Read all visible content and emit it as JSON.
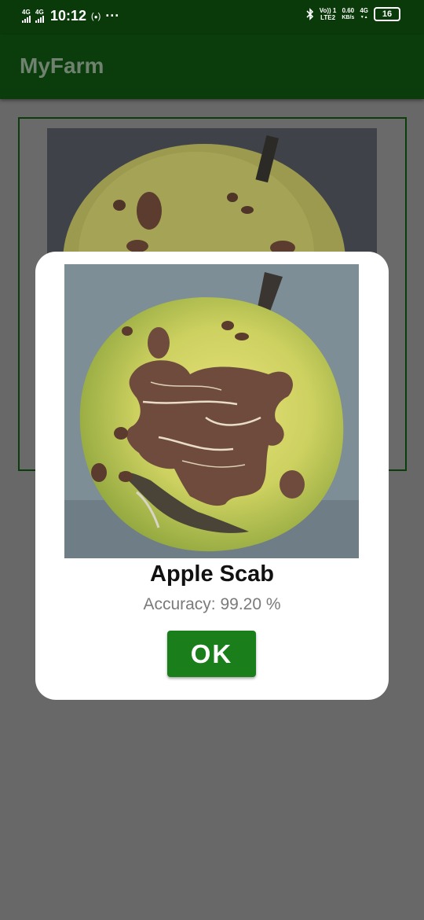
{
  "status_bar": {
    "sim1_label": "4G",
    "sim2_label": "4G",
    "time": "10:12",
    "hotspot_icon": "hotspot-icon",
    "more_icon": "···",
    "bluetooth_icon": "bluetooth-icon",
    "volte_top": "Vo)) 1",
    "volte_bottom": "LTE2",
    "speed_value": "0.60",
    "speed_unit": "KB/s",
    "net_top": "4G",
    "net_bottom": "▼▲",
    "battery": "16"
  },
  "app_bar": {
    "title": "MyFarm"
  },
  "dialog": {
    "disease_name": "Apple Scab",
    "accuracy": "Accuracy: 99.20 %",
    "ok_label": "OK"
  },
  "colors": {
    "app_bar": "#0b3c0b",
    "ok_button": "#1a7f1a",
    "scrim": "#686868"
  }
}
